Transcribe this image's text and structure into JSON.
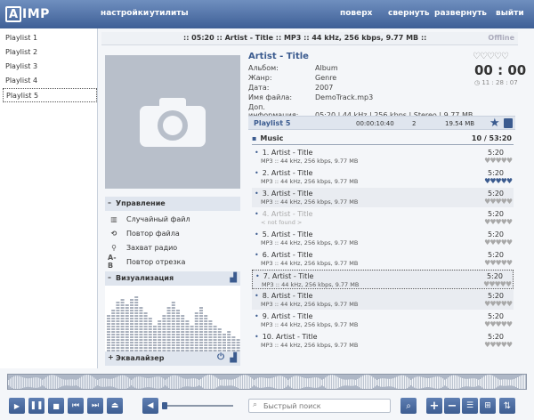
{
  "app": {
    "logo_text": "IMP"
  },
  "menu": {
    "settings": "настройки",
    "utilities": "утилиты",
    "always_on_top": "поверх",
    "minimize": "свернуть",
    "maximize": "развернуть",
    "exit": "выйти"
  },
  "sidebar": {
    "items": [
      {
        "label": "Playlist 1"
      },
      {
        "label": "Playlist 2"
      },
      {
        "label": "Playlist 3"
      },
      {
        "label": "Playlist 4"
      },
      {
        "label": "Playlist 5"
      }
    ]
  },
  "infobar": {
    "text": ":: 05:20 :: Artist - Title :: MP3 :: 44 kHz, 256 kbps, 9.77 MB ::",
    "status": "Offline"
  },
  "track_info": {
    "title": "Artist - Title",
    "fields": [
      {
        "key": "Альбом:",
        "value": "Album"
      },
      {
        "key": "Жанр:",
        "value": "Genre"
      },
      {
        "key": "Дата:",
        "value": "2007"
      },
      {
        "key": "Имя файла:",
        "value": "DemoTrack.mp3"
      },
      {
        "key": "Доп. информация:",
        "value": "05:20 | 44 kHz | 256 kbps | Stereo | 9.77 MB"
      }
    ],
    "time": "00 : 00",
    "clock": "11 : 28 : 07"
  },
  "playlist": {
    "name": "Playlist 5",
    "duration": "00:00:10:40",
    "count": "2",
    "size": "19.54 MB",
    "group": {
      "name": "Music",
      "stat": "10 / 53:20"
    },
    "tracks": [
      {
        "title": "1. Artist - Title",
        "sub": "MP3 :: 44 kHz, 256 kbps, 9.77 MB",
        "duration": "5:20",
        "rating": 0
      },
      {
        "title": "2. Artist - Title",
        "sub": "MP3 :: 44 kHz, 256 kbps, 9.77 MB",
        "duration": "5:20",
        "rating": 5
      },
      {
        "title": "3. Artist - Title",
        "sub": "MP3 :: 44 kHz, 256 kbps, 9.77 MB",
        "duration": "5:20",
        "rating": 0
      },
      {
        "title": "4. Artist - Title",
        "sub": "< not found >",
        "duration": "5:20",
        "rating": 0
      },
      {
        "title": "5. Artist - Title",
        "sub": "MP3 :: 44 kHz, 256 kbps, 9.77 MB",
        "duration": "5:20",
        "rating": 0
      },
      {
        "title": "6. Artist - Title",
        "sub": "MP3 :: 44 kHz, 256 kbps, 9.77 MB",
        "duration": "5:20",
        "rating": 0
      },
      {
        "title": "7. Artist - Title",
        "sub": "MP3 :: 44 kHz, 256 kbps, 9.77 MB",
        "duration": "5:20",
        "rating": 0
      },
      {
        "title": "8. Artist - Title",
        "sub": "MP3 :: 44 kHz, 256 kbps, 9.77 MB",
        "duration": "5:20",
        "rating": 0
      },
      {
        "title": "9. Artist - Title",
        "sub": "MP3 :: 44 kHz, 256 kbps, 9.77 MB",
        "duration": "5:20",
        "rating": 0
      },
      {
        "title": "10. Artist - Title",
        "sub": "MP3 :: 44 kHz, 256 kbps, 9.77 MB",
        "duration": "5:20",
        "rating": 0
      }
    ]
  },
  "control_panel": {
    "title": "Управление",
    "options": [
      {
        "label": "Случайный файл",
        "icon": "shuffle-icon"
      },
      {
        "label": "Повтор файла",
        "icon": "repeat-icon"
      },
      {
        "label": "Захват радио",
        "icon": "radio-capture-icon"
      },
      {
        "label": "Повтор отрезка",
        "icon": "ab-repeat-icon",
        "glyph": "A-B"
      }
    ]
  },
  "visualization": {
    "title": "Визуализация"
  },
  "equalizer": {
    "title": "Эквалайзер"
  },
  "search": {
    "placeholder": "Быстрый поиск"
  },
  "colors": {
    "accent": "#3b5b8f",
    "topbar": "#4a6aa0"
  }
}
